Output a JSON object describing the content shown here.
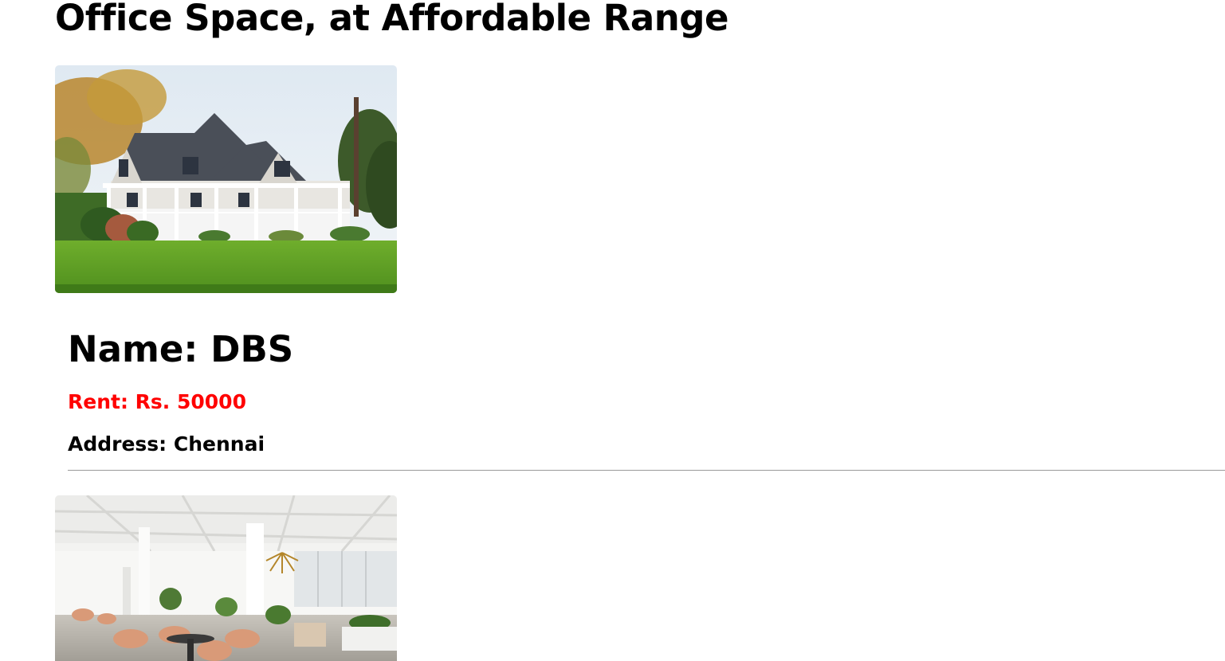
{
  "page": {
    "title": "Office Space, at Affordable Range"
  },
  "listings": [
    {
      "image": "house-photo",
      "name": "Name: DBS",
      "rent": "Rent: Rs. 50000",
      "address": "Address: Chennai"
    },
    {
      "image": "office-interior-photo"
    }
  ],
  "colors": {
    "rent_text": "#ff0000",
    "divider": "#9a9a9a"
  }
}
